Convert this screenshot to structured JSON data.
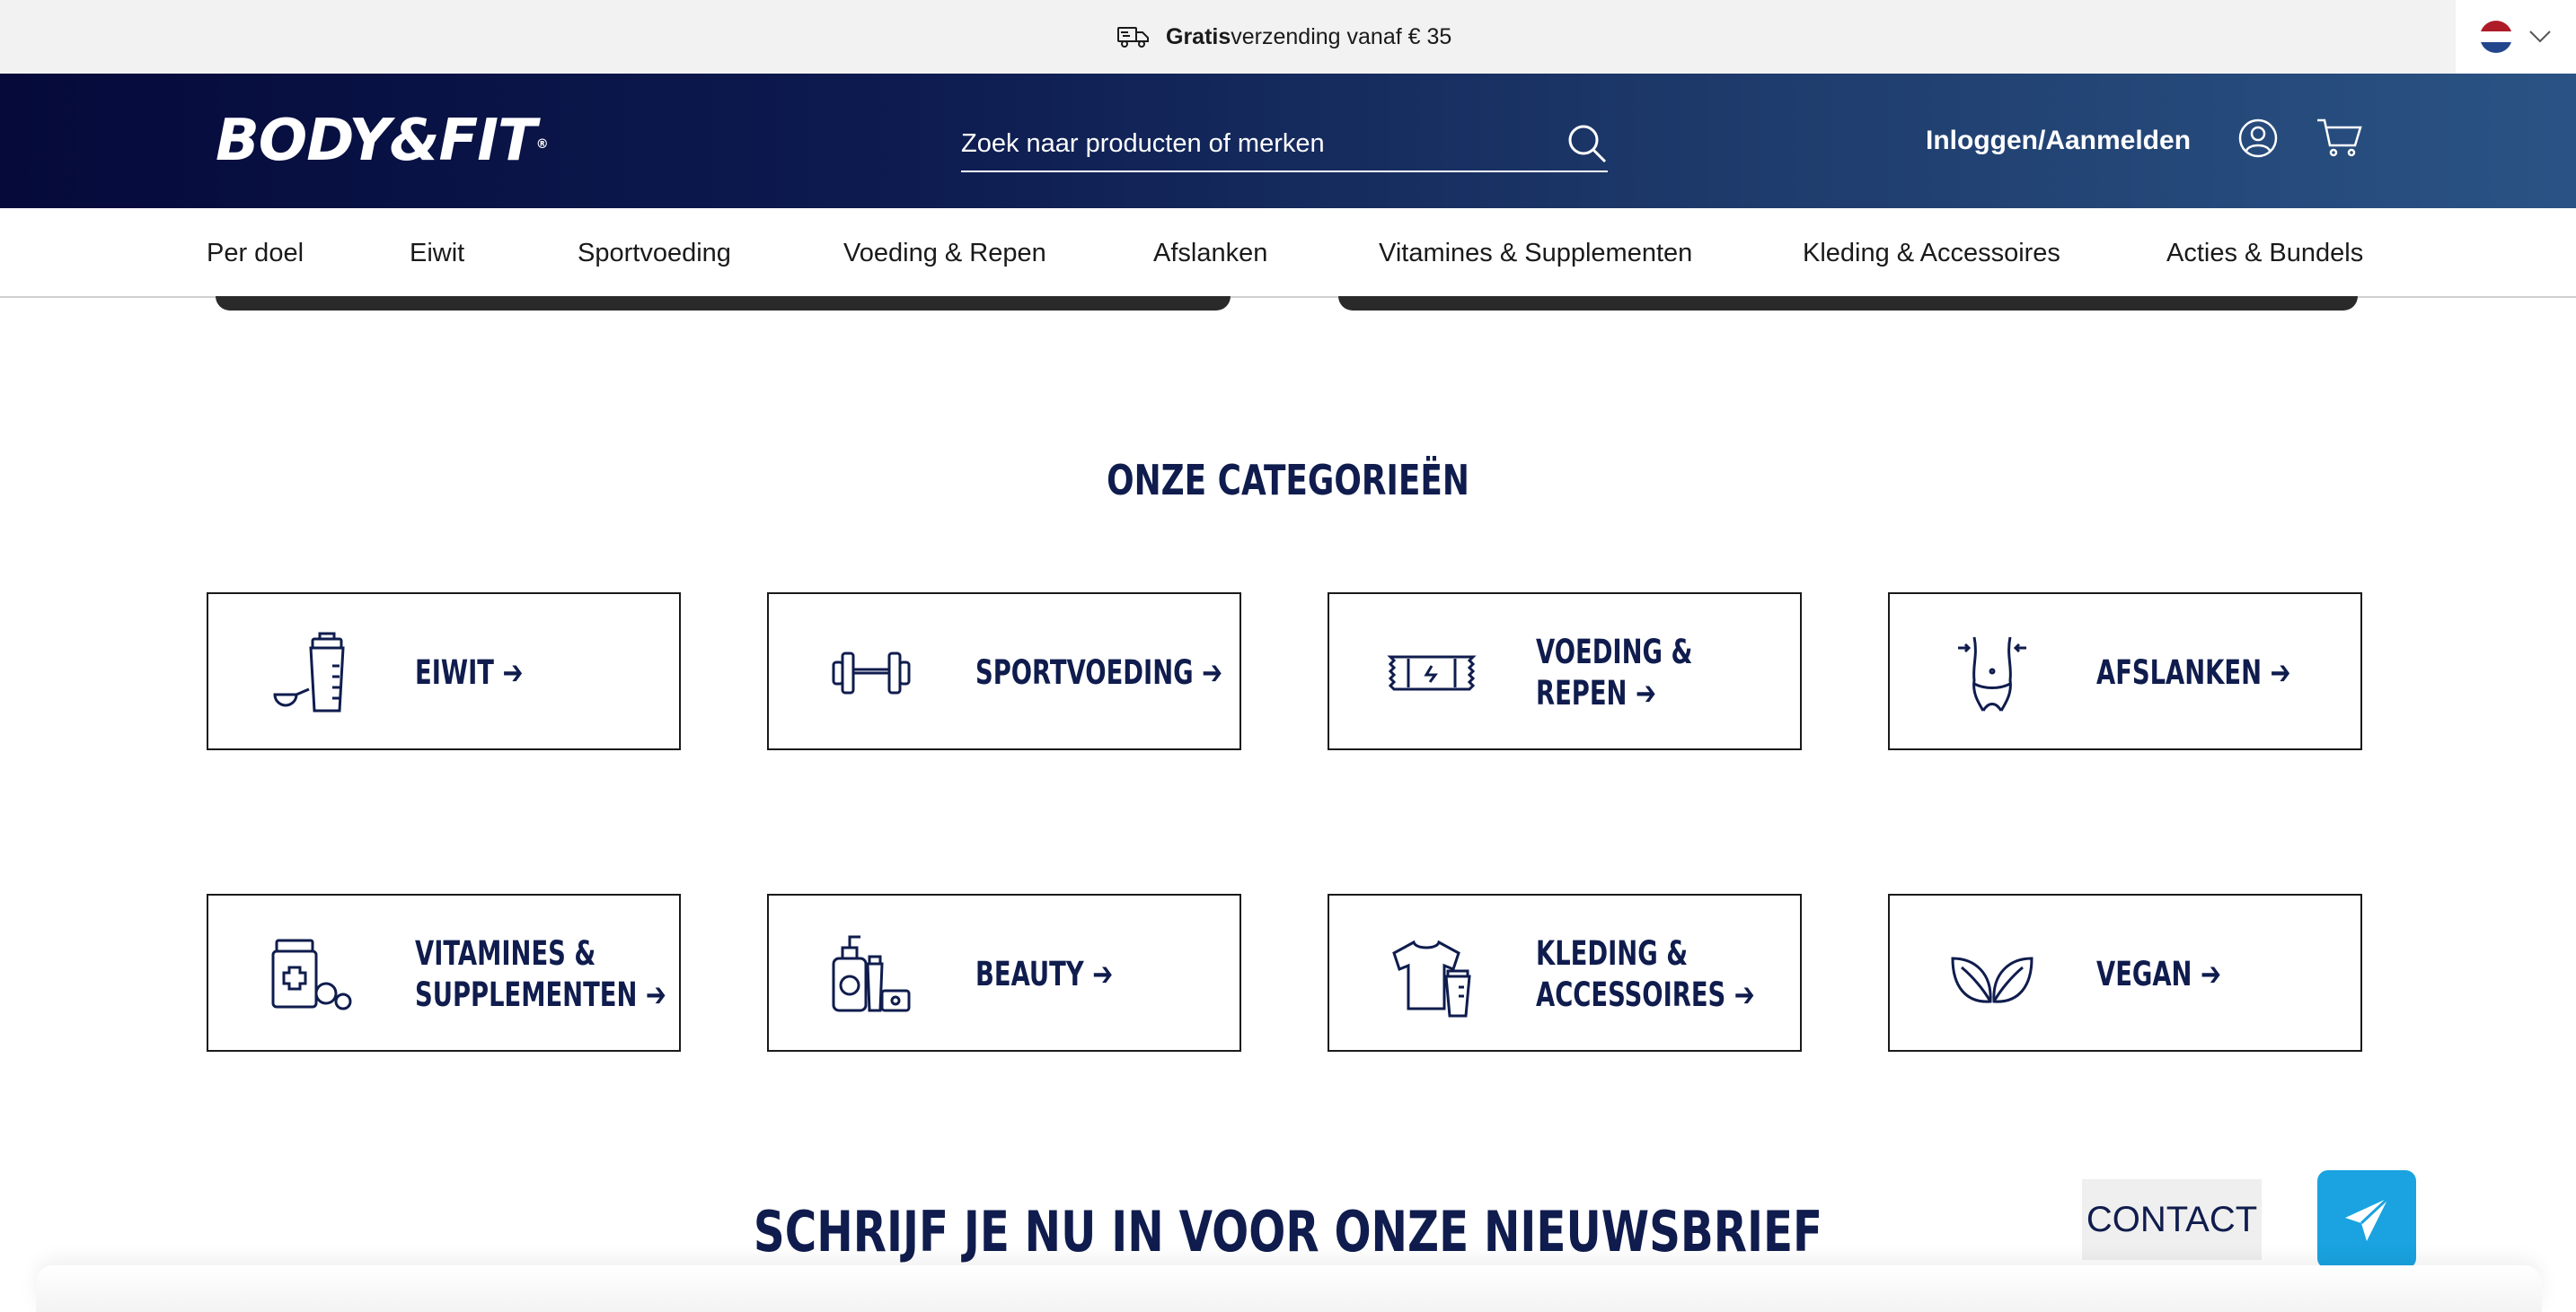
{
  "promo": {
    "icon": "truck-icon",
    "bold": "Gratis",
    "text": "verzending vanaf € 35"
  },
  "language": {
    "flag": "netherlands-flag-icon",
    "colors": [
      "#ae1c28",
      "#ffffff",
      "#21468b"
    ]
  },
  "header": {
    "logo": "BODY&FIT",
    "logo_mark": "®",
    "search_placeholder": "Zoek naar producten of merken",
    "login": "Inloggen/Aanmelden"
  },
  "nav": {
    "items": [
      "Per doel",
      "Eiwit",
      "Sportvoeding",
      "Voeding & Repen",
      "Afslanken",
      "Vitamines & Supplementen",
      "Kleding & Accessoires",
      "Acties & Bundels"
    ]
  },
  "categories": {
    "title": "ONZE CATEGORIEËN",
    "items": [
      {
        "label": "EIWIT ➔",
        "icon": "shaker-icon"
      },
      {
        "label": "SPORTVOEDING ➔",
        "icon": "dumbbell-icon"
      },
      {
        "label": "VOEDING &\nREPEN ➔",
        "icon": "bar-icon"
      },
      {
        "label": "AFSLANKEN ➔",
        "icon": "waist-icon"
      },
      {
        "label": "VITAMINES &\nSUPPLEMENTEN ➔",
        "icon": "pills-icon"
      },
      {
        "label": "BEAUTY ➔",
        "icon": "cosmetics-icon"
      },
      {
        "label": "KLEDING &\nACCESSOIRES ➔",
        "icon": "shirt-icon"
      },
      {
        "label": "VEGAN ➔",
        "icon": "leaf-icon"
      }
    ]
  },
  "newsletter": {
    "title": "SCHRIJF JE NU IN VOOR ONZE NIEUWSBRIEF"
  },
  "contact": {
    "label": "CONTACT"
  },
  "colors": {
    "navy": "#0f1c4d",
    "accent": "#1aa3e0"
  }
}
